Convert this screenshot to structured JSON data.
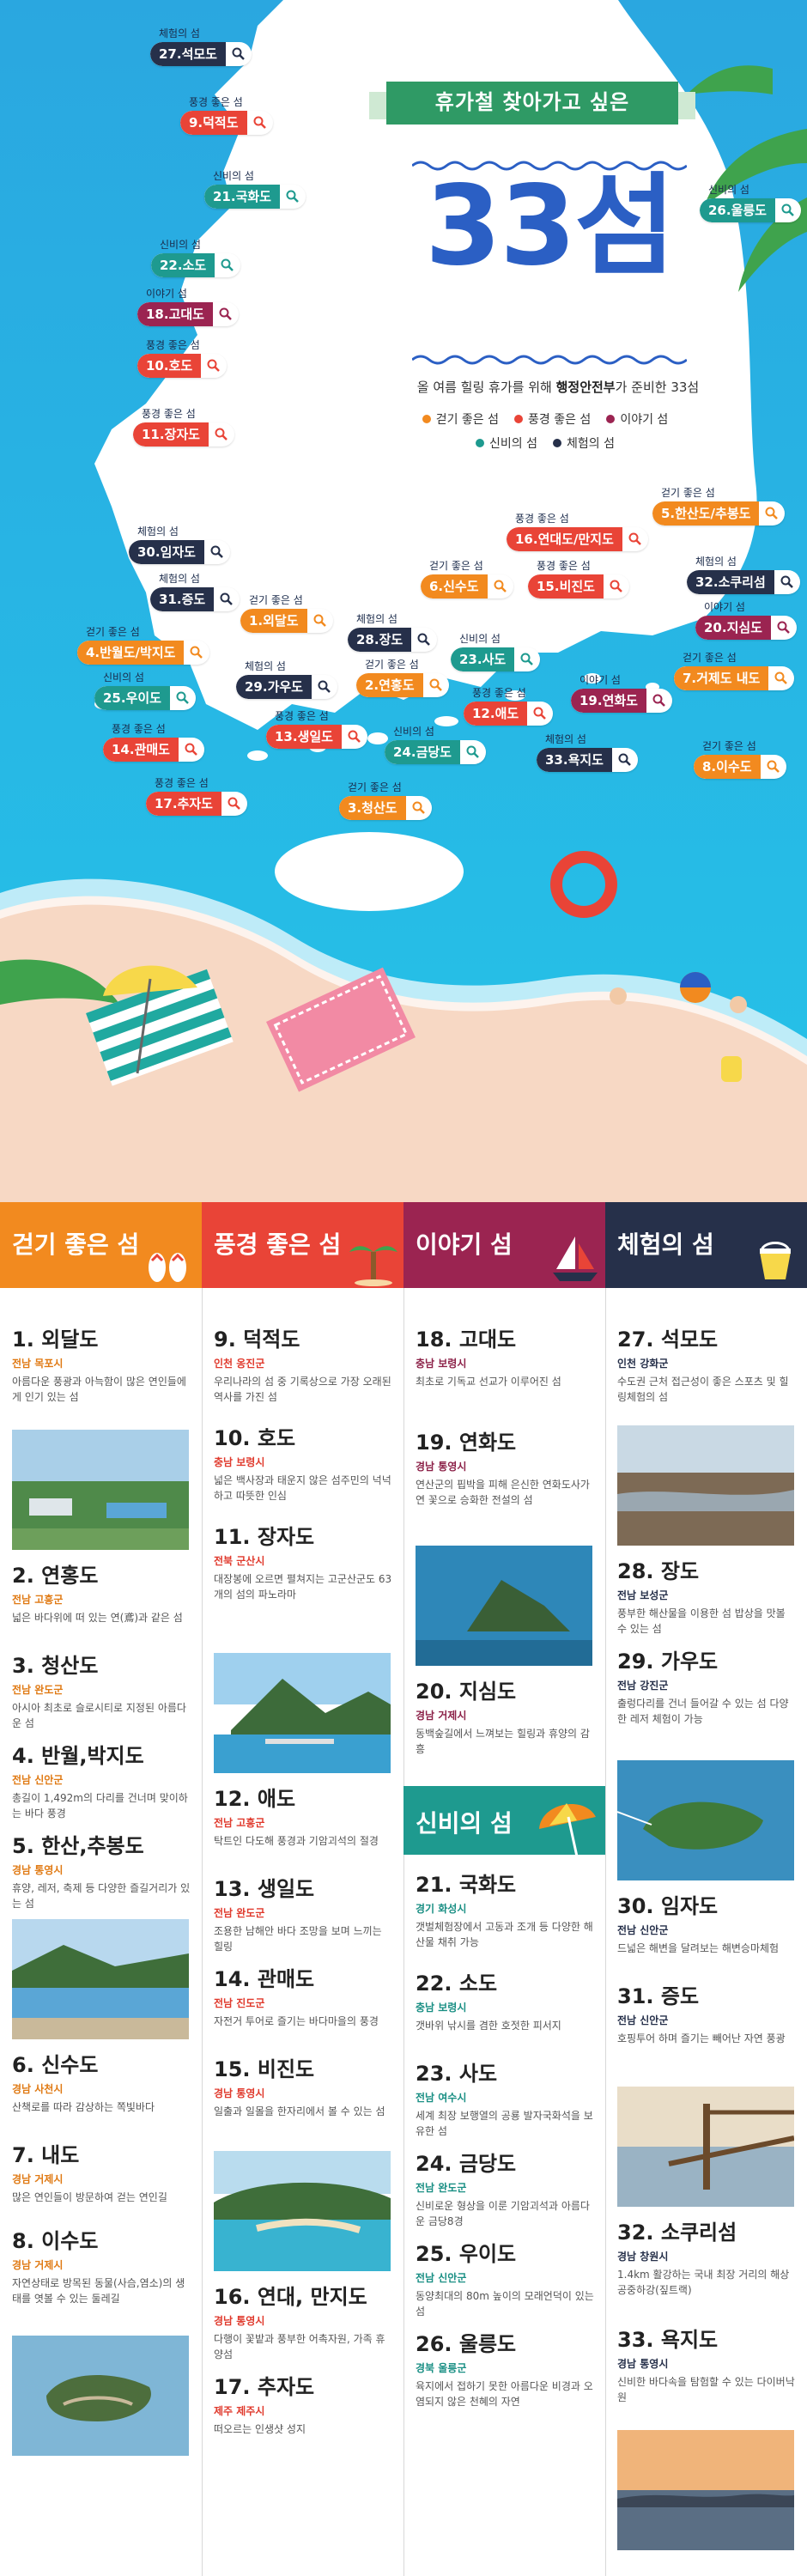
{
  "header": {
    "ribbon": "휴가철 찾아가고 싶은",
    "title": "33섬",
    "subtitle_pre": "올 여름 힐링 휴가를 위해 ",
    "subtitle_bold": "행정안전부",
    "subtitle_post": "가 준비한 33섬"
  },
  "legend": [
    {
      "label": "걷기 좋은 섬",
      "color": "#f28a1f"
    },
    {
      "label": "풍경 좋은 섬",
      "color": "#e94437"
    },
    {
      "label": "이야기 섬",
      "color": "#9b2451"
    },
    {
      "label": "신비의 섬",
      "color": "#1e9a8f"
    },
    {
      "label": "체험의 섬",
      "color": "#26304a"
    }
  ],
  "map_tags": [
    {
      "cat": "체험의 섬",
      "name": "27.석모도"
    },
    {
      "cat": "풍경 좋은 섬",
      "name": "9.덕적도"
    },
    {
      "cat": "신비의 섬",
      "name": "21.국화도"
    },
    {
      "cat": "신비의 섬",
      "name": "22.소도"
    },
    {
      "cat": "이야기 섬",
      "name": "18.고대도"
    },
    {
      "cat": "풍경 좋은 섬",
      "name": "10.호도"
    },
    {
      "cat": "풍경 좋은 섬",
      "name": "11.장자도"
    },
    {
      "cat": "신비의 섬",
      "name": "26.울릉도"
    },
    {
      "cat": "걷기 좋은 섬",
      "name": "5.한산도/추봉도"
    },
    {
      "cat": "풍경 좋은 섬",
      "name": "16.연대도/만지도"
    },
    {
      "cat": "풍경 좋은 섬",
      "name": "15.비진도"
    },
    {
      "cat": "걷기 좋은 섬",
      "name": "6.신수도"
    },
    {
      "cat": "체험의 섬",
      "name": "32.소쿠리섬"
    },
    {
      "cat": "이야기 섬",
      "name": "20.지심도"
    },
    {
      "cat": "체험의 섬",
      "name": "30.임자도"
    },
    {
      "cat": "체험의 섬",
      "name": "31.증도"
    },
    {
      "cat": "걷기 좋은 섬",
      "name": "1.외달도"
    },
    {
      "cat": "걷기 좋은 섬",
      "name": "4.반월도/박지도"
    },
    {
      "cat": "체험의 섬",
      "name": "28.장도"
    },
    {
      "cat": "신비의 섬",
      "name": "23.사도"
    },
    {
      "cat": "걷기 좋은 섬",
      "name": "7.거제도 내도"
    },
    {
      "cat": "신비의 섬",
      "name": "25.우이도"
    },
    {
      "cat": "체험의 섬",
      "name": "29.가우도"
    },
    {
      "cat": "걷기 좋은 섬",
      "name": "2.연홍도"
    },
    {
      "cat": "풍경 좋은 섬",
      "name": "12.애도"
    },
    {
      "cat": "이야기 섬",
      "name": "19.연화도"
    },
    {
      "cat": "풍경 좋은 섬",
      "name": "14.관매도"
    },
    {
      "cat": "풍경 좋은 섬",
      "name": "13.생일도"
    },
    {
      "cat": "신비의 섬",
      "name": "24.금당도"
    },
    {
      "cat": "체험의 섬",
      "name": "33.욕지도"
    },
    {
      "cat": "걷기 좋은 섬",
      "name": "8.이수도"
    },
    {
      "cat": "풍경 좋은 섬",
      "name": "17.추자도"
    },
    {
      "cat": "걷기 좋은 섬",
      "name": "3.청산도"
    }
  ],
  "columns": [
    {
      "title": "걷기 좋은 섬",
      "color": "#f28a1f"
    },
    {
      "title": "풍경 좋은 섬",
      "color": "#e94437"
    },
    {
      "title": "이야기 섬",
      "color": "#9b2451"
    },
    {
      "title": "체험의 섬",
      "color": "#26304a"
    }
  ],
  "section_mystery": {
    "title": "신비의 섬",
    "color": "#1e9a8f"
  },
  "islands": {
    "walk": [
      {
        "title": "1. 외달도",
        "region": "전남 목포시",
        "desc": "아름다운 풍광과 아늑함이 많은 연인들에게 인기 있는 섬"
      },
      {
        "title": "2. 연홍도",
        "region": "전남 고흥군",
        "desc": "넓은 바다위에 떠 있는 연(鳶)과 같은 섬"
      },
      {
        "title": "3. 청산도",
        "region": "전남 완도군",
        "desc": "아시아 최초로 슬로시티로 지정된 아름다운 섬"
      },
      {
        "title": "4. 반월,박지도",
        "region": "전남 신안군",
        "desc": "총길이 1,492m의 다리를 건너며 맞이하는 바다 풍경"
      },
      {
        "title": "5. 한산,추봉도",
        "region": "경남 통영시",
        "desc": "휴양, 레저, 축제 등 다양한 즐길거리가 있는 섬"
      },
      {
        "title": "6. 신수도",
        "region": "경남 사천시",
        "desc": "산책로를 따라 감상하는 쪽빛바다"
      },
      {
        "title": "7. 내도",
        "region": "경남 거제시",
        "desc": "많은 연인들이 방문하여 걷는 연인길"
      },
      {
        "title": "8. 이수도",
        "region": "경남 거제시",
        "desc": "자연상태로 방목된 동물(사슴,염소)의 생태를 엿볼 수 있는 둘레길"
      }
    ],
    "scenery": [
      {
        "title": "9. 덕적도",
        "region": "인천 옹진군",
        "desc": "우리나라의 섬 중 기록상으로 가장 오래된 역사를 가진 섬"
      },
      {
        "title": "10. 호도",
        "region": "충남 보령시",
        "desc": "넓은 백사장과 태운지 않은 섬주민의 넉넉하고 따뜻한 인심"
      },
      {
        "title": "11. 장자도",
        "region": "전북 군산시",
        "desc": "대장봉에 오르면 펼쳐지는 고군산군도 63개의 섬의 파노라마"
      },
      {
        "title": "12. 애도",
        "region": "전남 고흥군",
        "desc": "탁트인 다도해 풍경과 기암괴석의 절경"
      },
      {
        "title": "13. 생일도",
        "region": "전남 완도군",
        "desc": "조용한 남해안 바다 조망을 보며 느끼는 힐링"
      },
      {
        "title": "14. 관매도",
        "region": "전남 진도군",
        "desc": "자전거 투어로 즐기는 바다마을의 풍경"
      },
      {
        "title": "15. 비진도",
        "region": "경남 통영시",
        "desc": "일출과 일몰을 한자리에서 볼 수 있는 섬"
      },
      {
        "title": "16. 연대, 만지도",
        "region": "경남 통영시",
        "desc": "다행이 꽃밭과 풍부한 어촉자원, 가족 휴양섬"
      },
      {
        "title": "17. 추자도",
        "region": "제주 제주시",
        "desc": "떠오르는 인생샷 성지"
      }
    ],
    "story": [
      {
        "title": "18. 고대도",
        "region": "충남 보령시",
        "desc": "최초로 기독교 선교가 이루어진 섬"
      },
      {
        "title": "19. 연화도",
        "region": "경남 통영시",
        "desc": "연산군의 핍박을 피해 은신한 연화도사가 연 꽃으로 승화한 전설의 섬"
      },
      {
        "title": "20. 지심도",
        "region": "경남 거제시",
        "desc": "동백숲길에서 느껴보는 힐링과 휴양의 감흥"
      }
    ],
    "mystery": [
      {
        "title": "21. 국화도",
        "region": "경기 화성시",
        "desc": "갯벌체험장에서 고동과 조개 등 다양한 해산물 채취 가능"
      },
      {
        "title": "22. 소도",
        "region": "충남 보령시",
        "desc": "갯바위 낚시를 겸한 호젓한 피서지"
      },
      {
        "title": "23. 사도",
        "region": "전남 여수시",
        "desc": "세계 최장 보행열의 공룡 발자국화석을 보유한 섬"
      },
      {
        "title": "24. 금당도",
        "region": "전남 완도군",
        "desc": "신비로운 형상을 이룬 기암괴석과 아름다운 금당8경"
      },
      {
        "title": "25. 우이도",
        "region": "전남 신안군",
        "desc": "동양최대의 80m 높이의 모래언덕이 있는 섬"
      },
      {
        "title": "26. 울릉도",
        "region": "경북 울릉군",
        "desc": "육지에서 접하기 못한 아름다운 비경과 오염되지 않은 천혜의 자연"
      }
    ],
    "experience": [
      {
        "title": "27. 석모도",
        "region": "인천 강화군",
        "desc": "수도권 근처 접근성이 좋은 스포츠 및 힐링체험의 섬"
      },
      {
        "title": "28. 장도",
        "region": "전남 보성군",
        "desc": "풍부한 해산물을 이용한 섬 밥상을 맛볼 수 있는 섬"
      },
      {
        "title": "29. 가우도",
        "region": "전남 강진군",
        "desc": "출렁다리를 건너 들어갈 수 있는 섬 다양한 레저 체험이 가능"
      },
      {
        "title": "30. 임자도",
        "region": "전남 신안군",
        "desc": "드넓은 해변을 달려보는 해변승마체험"
      },
      {
        "title": "31. 증도",
        "region": "전남 신안군",
        "desc": "호핑투어 하며 즐기는 빼어난 자연 풍광"
      },
      {
        "title": "32. 소쿠리섬",
        "region": "경남 창원시",
        "desc": "1.4km 활강하는 국내 최장 거리의 해상공중하강(짚트랙)"
      },
      {
        "title": "33. 욕지도",
        "region": "경남 통영시",
        "desc": "신비한 바다속을 탐험할 수 있는 다이버낙원"
      }
    ]
  }
}
